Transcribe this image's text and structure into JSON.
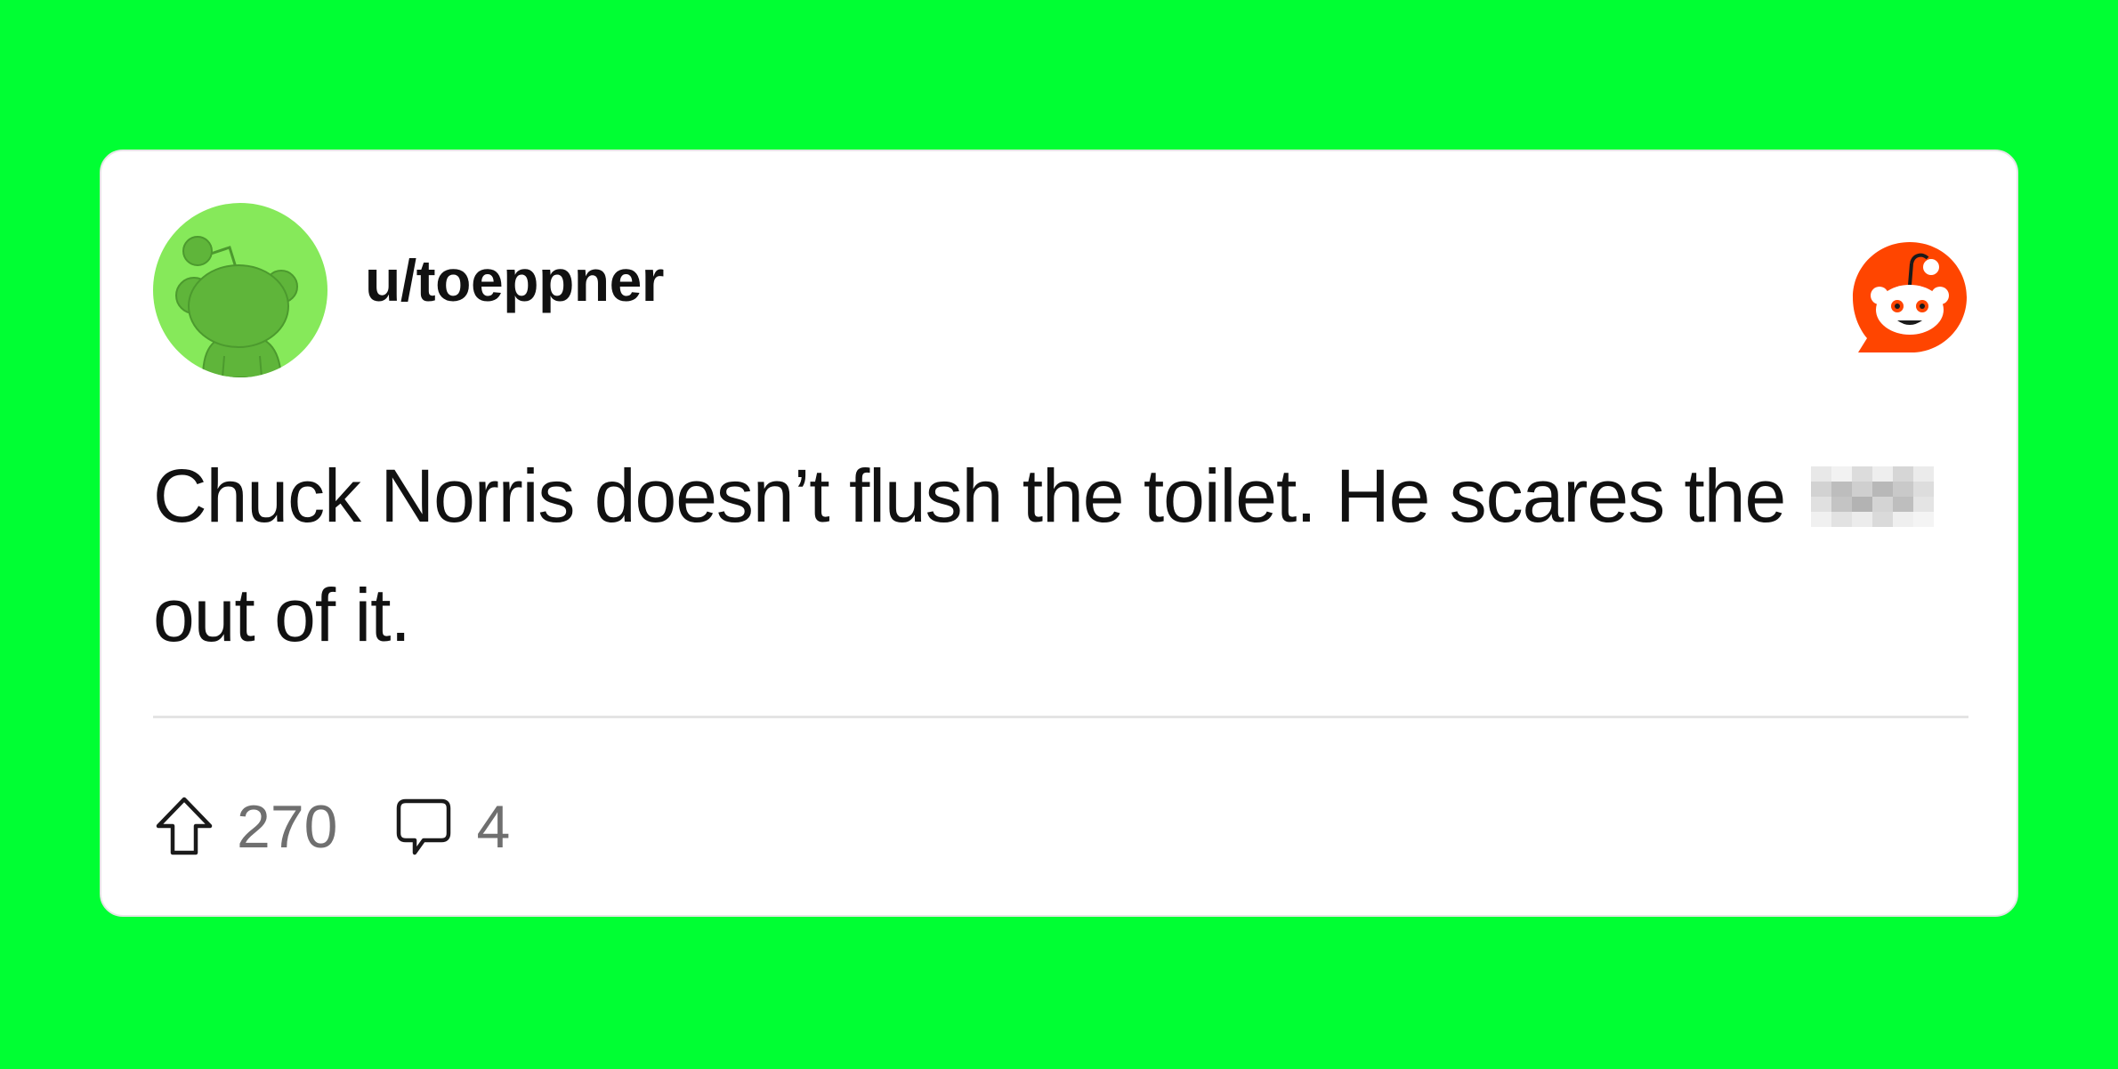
{
  "post": {
    "username": "u/toeppner",
    "body_line_1": "Chuck Norris doesn’t flush the toilet. He scares the",
    "body_line_2": "out of it.",
    "upvotes": "270",
    "comments": "4"
  },
  "icons": {
    "avatar": "reddit-snoo-avatar-icon",
    "brand": "reddit-logo-icon",
    "upvote": "upvote-arrow-icon",
    "comment": "comment-bubble-icon"
  },
  "colors": {
    "background": "#00ff33",
    "card": "#ffffff",
    "avatar_bg": "#86e95a",
    "avatar_snoo": "#5fb53a",
    "reddit_orange": "#ff4500",
    "text": "#111111",
    "muted": "#6f6f6f"
  }
}
